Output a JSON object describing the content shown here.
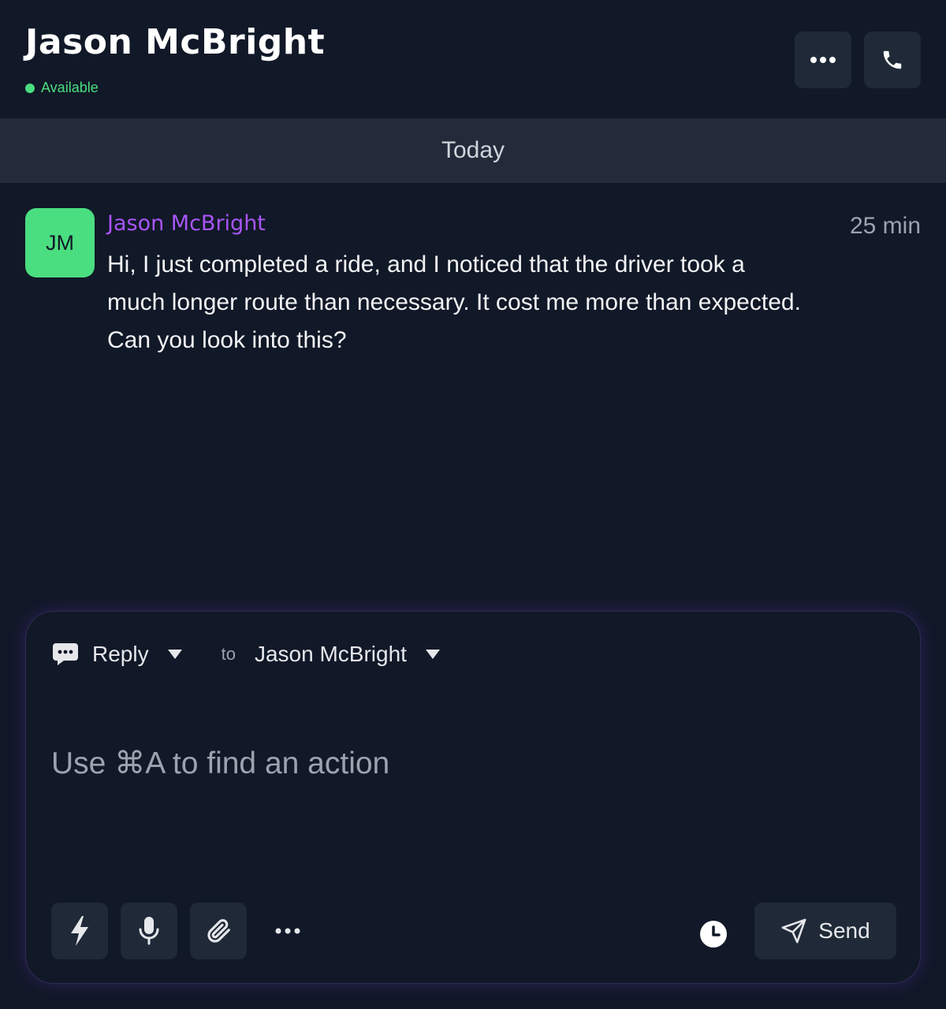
{
  "header": {
    "contact_name": "Jason McBright",
    "status": "Available",
    "status_color": "#4ade80",
    "more_icon": "more-horizontal-icon",
    "call_icon": "phone-icon"
  },
  "date_divider": "Today",
  "messages": [
    {
      "avatar_initials": "JM",
      "avatar_color": "#4ade80",
      "sender": "Jason McBright",
      "sender_color": "#a855f7",
      "time": "25 min",
      "text": "Hi, I just completed a ride, and I noticed that the driver took a much longer route than necessary. It cost me more than expected. Can you look into this?"
    }
  ],
  "composer": {
    "mode_icon": "chat-bubble-icon",
    "mode_label": "Reply",
    "to_label": "to",
    "recipient": "Jason McBright",
    "placeholder": "Use ⌘A to find an action",
    "tools": [
      "lightning-icon",
      "microphone-icon",
      "paperclip-icon",
      "more-horizontal-icon"
    ],
    "schedule_icon": "clock-icon",
    "send_label": "Send",
    "send_icon": "send-icon"
  }
}
